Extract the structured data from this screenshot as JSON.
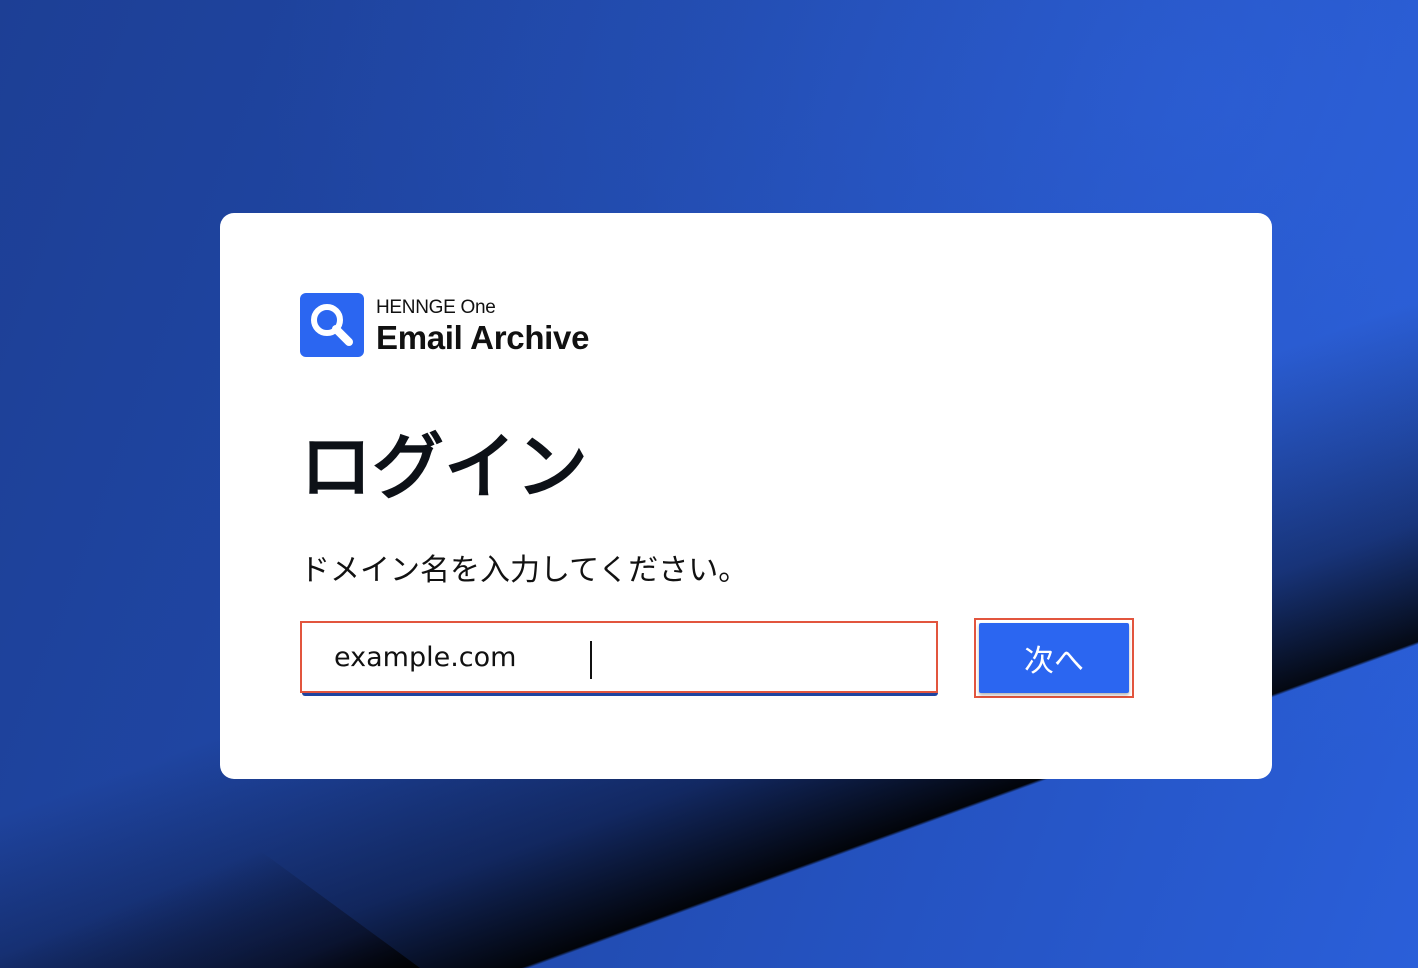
{
  "logo": {
    "brand": "HENNGE One",
    "product": "Email Archive",
    "icon": "magnifier-icon"
  },
  "login": {
    "title": "ログイン",
    "subtitle": "ドメイン名を入力してください。",
    "domain_value": "example.com",
    "next_label": "次へ"
  },
  "colors": {
    "accent": "#2b66f1",
    "highlight_border": "#e2553e",
    "background": "#1f44a0"
  }
}
